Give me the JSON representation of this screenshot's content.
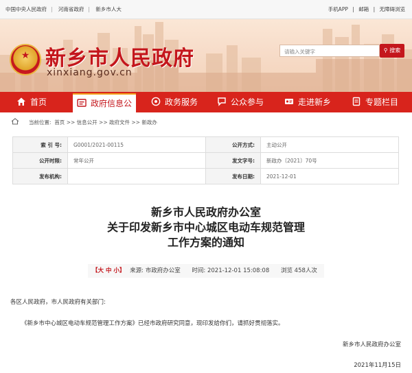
{
  "topbar": {
    "links": [
      "中国中央人民政府",
      "河南省政府",
      "新乡市人大"
    ],
    "right_links": [
      "手机APP",
      "邮箱",
      "无障碍浏览"
    ],
    "separator": "|"
  },
  "header": {
    "site_title": "新乡市人民政府",
    "site_url": "xinxiang.gov.cn",
    "search_placeholder": "请输入关键字",
    "search_button": "搜索"
  },
  "nav": {
    "items": [
      {
        "label": "首页",
        "icon": "home-icon"
      },
      {
        "label": "政府信息公开",
        "icon": "info-public-icon"
      },
      {
        "label": "政务服务",
        "icon": "service-icon"
      },
      {
        "label": "公众参与",
        "icon": "chat-icon"
      },
      {
        "label": "走进新乡",
        "icon": "id-card-icon"
      },
      {
        "label": "专题栏目",
        "icon": "document-icon"
      }
    ],
    "active_label_visible": "政府信息公"
  },
  "breadcrumb": {
    "prefix": "当前位置:",
    "path": "首页 >> 信息公开 >> 政府文件 >> 新政办"
  },
  "info_table": {
    "rows": [
      {
        "k1": "索 引 号:",
        "v1": "G0001/2021-00115",
        "k2": "公开方式:",
        "v2": "主动公开"
      },
      {
        "k1": "公开时限:",
        "v1": "常年公开",
        "k2": "发文字号:",
        "v2": "新政办〔2021〕70号"
      },
      {
        "k1": "发布机构:",
        "v1": "",
        "k2": "发布日期:",
        "v2": "2021-12-01"
      }
    ]
  },
  "article": {
    "title_lines": [
      "新乡市人民政府办公室",
      "关于印发新乡市中心城区电动车规范管理",
      "工作方案的通知"
    ],
    "meta": {
      "font_size": "【大 中 小】",
      "source": "来源:   市政府办公室",
      "time": "时间:   2021-12-01 15:08:08",
      "views": "浏览 458人次"
    },
    "salutation": "各区人民政府，市人民政府有关部门:",
    "paragraph": "《新乡市中心城区电动车规范管理工作方案》已经市政府研究同意，现印发给你们，请抓好贯彻落实。",
    "signature": "新乡市人民政府办公室",
    "date": "2021年11月15日"
  }
}
